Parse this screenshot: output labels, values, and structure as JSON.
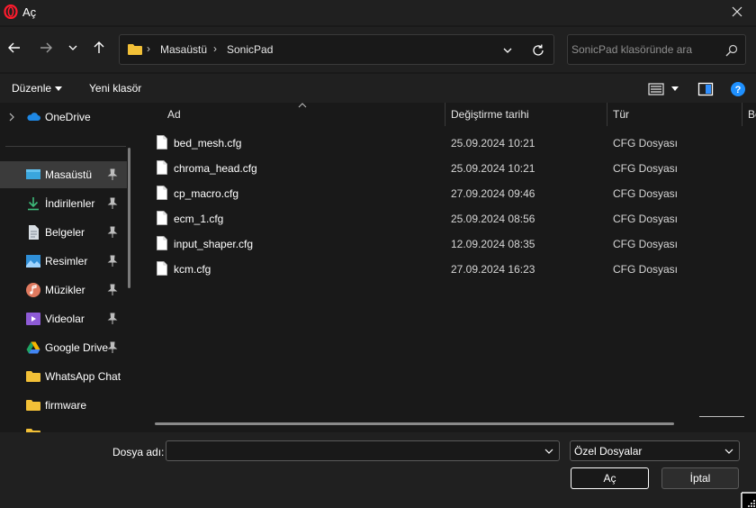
{
  "window": {
    "title": "Aç"
  },
  "icons": {
    "app": "opera-icon",
    "close": "close-icon",
    "back": "arrow-left-icon",
    "forward": "arrow-right-icon",
    "recent": "chevron-down-icon",
    "up": "arrow-up-icon",
    "refresh": "refresh-icon",
    "search": "search-icon",
    "view": "view-list-icon",
    "preview": "preview-pane-icon",
    "help": "help-icon"
  },
  "address": {
    "crumbs": [
      "Masaüstü",
      "SonicPad"
    ]
  },
  "search": {
    "placeholder": "SonicPad klasöründe ara"
  },
  "toolbar": {
    "organize_label": "Düzenle",
    "new_folder_label": "Yeni klasör"
  },
  "sidebar": {
    "onedrive_label": "OneDrive",
    "items": [
      {
        "label": "Masaüstü",
        "icon": "desktop-icon",
        "pinned": true,
        "selected": true
      },
      {
        "label": "İndirilenler",
        "icon": "download-icon",
        "pinned": true
      },
      {
        "label": "Belgeler",
        "icon": "documents-icon",
        "pinned": true
      },
      {
        "label": "Resimler",
        "icon": "pictures-icon",
        "pinned": true
      },
      {
        "label": "Müzikler",
        "icon": "music-icon",
        "pinned": true
      },
      {
        "label": "Videolar",
        "icon": "videos-icon",
        "pinned": true
      },
      {
        "label": "Google Drive",
        "icon": "google-drive-icon",
        "pinned": true
      },
      {
        "label": "WhatsApp Chat",
        "icon": "folder-icon",
        "pinned": false
      },
      {
        "label": "firmware",
        "icon": "folder-icon",
        "pinned": false
      }
    ]
  },
  "columns": {
    "name": "Ad",
    "date": "Değiştirme tarihi",
    "type": "Tür",
    "size": "Bo"
  },
  "files": [
    {
      "name": "bed_mesh.cfg",
      "date": "25.09.2024 10:21",
      "type": "CFG Dosyası"
    },
    {
      "name": "chroma_head.cfg",
      "date": "25.09.2024 10:21",
      "type": "CFG Dosyası"
    },
    {
      "name": "cp_macro.cfg",
      "date": "27.09.2024 09:46",
      "type": "CFG Dosyası"
    },
    {
      "name": "ecm_1.cfg",
      "date": "25.09.2024 08:56",
      "type": "CFG Dosyası"
    },
    {
      "name": "input_shaper.cfg",
      "date": "12.09.2024 08:35",
      "type": "CFG Dosyası"
    },
    {
      "name": "kcm.cfg",
      "date": "27.09.2024 16:23",
      "type": "CFG Dosyası"
    }
  ],
  "bottom": {
    "filename_label": "Dosya adı:",
    "filename_value": "",
    "filetype_value": "Özel Dosyalar",
    "open_label": "Aç",
    "cancel_label": "İptal"
  },
  "colors": {
    "background": "#191919",
    "chrome": "#202020",
    "selected": "#3b3b3b",
    "accent": "#1e90ff"
  }
}
